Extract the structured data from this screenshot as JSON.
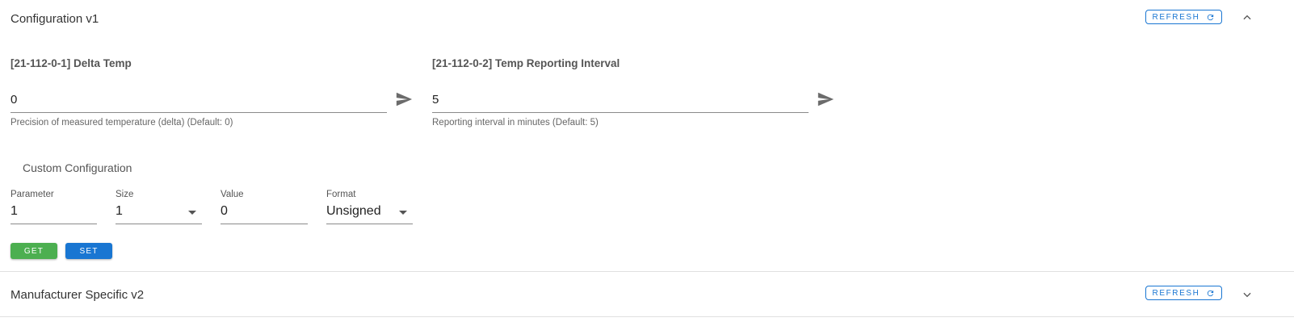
{
  "panels": {
    "configuration": {
      "title": "Configuration v1",
      "refresh_label": "REFRESH",
      "expanded": true
    },
    "manufacturer": {
      "title": "Manufacturer Specific v2",
      "refresh_label": "REFRESH",
      "expanded": false
    }
  },
  "parameters": [
    {
      "title": "[21-112-0-1] Delta Temp",
      "value": "0",
      "hint": "Precision of measured temperature (delta) (Default: 0)"
    },
    {
      "title": "[21-112-0-2] Temp Reporting Interval",
      "value": "5",
      "hint": "Reporting interval in minutes (Default: 5)"
    }
  ],
  "custom_config": {
    "title": "Custom Configuration",
    "parameter": {
      "label": "Parameter",
      "value": "1"
    },
    "size": {
      "label": "Size",
      "value": "1"
    },
    "value": {
      "label": "Value",
      "value": "0"
    },
    "format": {
      "label": "Format",
      "value": "Unsigned"
    },
    "get_label": "GET",
    "set_label": "SET"
  },
  "colors": {
    "primary": "#1976d2",
    "get_button": "#4caf50",
    "set_button": "#1976d2"
  },
  "icons": {
    "refresh": "refresh-icon",
    "collapse": "chevron-up-icon",
    "expand": "chevron-down-icon",
    "send": "send-icon",
    "dropdown": "arrow-drop-down-icon"
  }
}
